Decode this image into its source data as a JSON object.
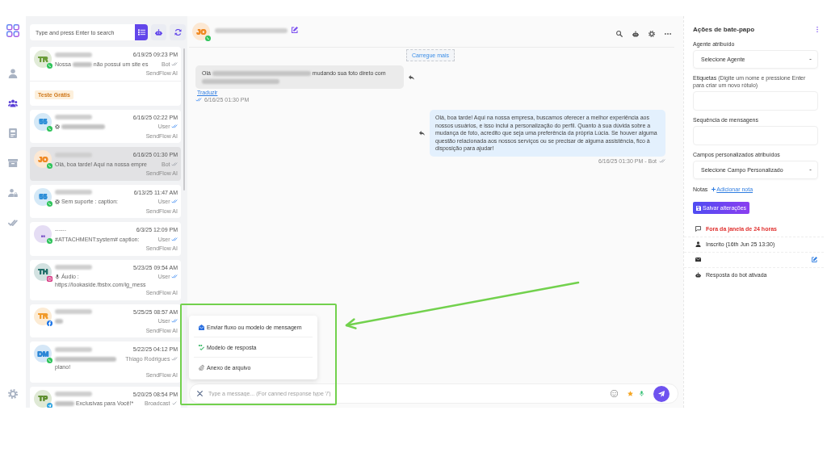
{
  "nav_rail": {
    "items": [
      {
        "kind": "contacts",
        "selected": false
      },
      {
        "kind": "team",
        "selected": true
      },
      {
        "kind": "inbox",
        "selected": false
      },
      {
        "kind": "archive",
        "selected": false
      },
      {
        "kind": "user_lock",
        "selected": false
      },
      {
        "kind": "tasks",
        "selected": false
      },
      {
        "kind": "settings",
        "selected": false
      }
    ]
  },
  "conversation_list": {
    "search": {
      "placeholder": "Type and press Enter to search"
    },
    "tools": [
      {
        "kind": "list",
        "selected": true
      },
      {
        "kind": "robot",
        "selected": false
      },
      {
        "kind": "refresh",
        "selected": false
      }
    ],
    "conversations": [
      {
        "initials": "TR",
        "color": "#6a9c38",
        "channel": {
          "kind": "whatsapp"
        },
        "name_blurred": true,
        "preview": [
          {
            "kind": "text",
            "text": "Nossa"
          },
          {
            "kind": "blurphrase"
          },
          {
            "kind": "text",
            "text": "não possui um site es"
          }
        ],
        "time": "6/19/25 09:23 PM",
        "sender": "Bot",
        "delivery": {
          "kind": "double",
          "read": false
        },
        "agent": "SendFlow AI",
        "tags": [
          "Teste Grátis"
        ],
        "selected": false
      },
      {
        "initials": "55",
        "color": "#2f8fd8",
        "channel": {
          "kind": "whatsapp"
        },
        "name_blurred": true,
        "preview": [
          {
            "kind": "gear"
          },
          {
            "kind": "blurclause"
          }
        ],
        "time": "6/16/25 02:22 PM",
        "sender": "User",
        "delivery": {
          "kind": "double",
          "read": true
        },
        "agent": "SendFlow AI",
        "selected": false
      },
      {
        "initials": "JO",
        "color": "#f08a24",
        "channel": {
          "kind": "whatsapp"
        },
        "name_blurred": true,
        "preview": [
          {
            "kind": "text",
            "text": "Olá, boa tarde! Aqui na nossa empre"
          }
        ],
        "time": "6/16/25 01:30 PM",
        "sender": "Bot",
        "delivery": {
          "kind": "double",
          "read": false
        },
        "agent": "SendFlow AI",
        "selected": true
      },
      {
        "initials": "55",
        "color": "#2f8fd8",
        "channel": {
          "kind": "whatsapp"
        },
        "name_blurred": true,
        "preview": [
          {
            "kind": "gear"
          },
          {
            "kind": "text",
            "text": "Sem suporte : caption:"
          }
        ],
        "time": "6/13/25 11:47 AM",
        "sender": "User",
        "delivery": {
          "kind": "double",
          "read": true
        },
        "agent": "SendFlow AI",
        "selected": false
      },
      {
        "initials": "..",
        "color": "#7d55c7",
        "channel": {
          "kind": "whatsapp"
        },
        "name": "------",
        "preview": [
          {
            "kind": "text",
            "text": "#ATTACHMENT:system# caption:"
          }
        ],
        "time": "6/3/25 12:09 PM",
        "sender": "User",
        "delivery": {
          "kind": "double",
          "read": true
        },
        "agent": "SendFlow AI",
        "selected": false
      },
      {
        "initials": "TH",
        "color": "#23706a",
        "channel": {
          "kind": "instagram"
        },
        "name_blurred": true,
        "preview": [
          {
            "kind": "mic"
          },
          {
            "kind": "text",
            "text": "Áudio :"
          },
          {
            "kind": "text",
            "text": "https://lookaside.fbsbx.com/ig_mess"
          }
        ],
        "time": "5/23/25 09:54 AM",
        "sender": "User",
        "delivery": {
          "kind": "double",
          "read": true
        },
        "agent": "SendFlow AI",
        "selected": false
      },
      {
        "initials": "TR",
        "color": "#f19a2a",
        "channel": {
          "kind": "facebook"
        },
        "name_blurred": true,
        "preview": [
          {
            "kind": "blurword"
          }
        ],
        "time": "5/25/25 08:57 AM",
        "sender": "User",
        "delivery": {
          "kind": "double",
          "read": true
        },
        "agent": "SendFlow AI",
        "selected": false
      },
      {
        "initials": "DM",
        "color": "#2c86d6",
        "channel": {
          "kind": "whatsapp"
        },
        "name_blurred": true,
        "preview": [
          {
            "kind": "blurline"
          },
          {
            "kind": "text",
            "text": "plano!"
          }
        ],
        "time": "5/22/25 04:12 PM",
        "sender": "Thiago Rodrigues",
        "delivery": {
          "kind": "double",
          "read": false
        },
        "agent": "SendFlow AI",
        "selected": false
      },
      {
        "initials": "TP",
        "color": "#5f8f2f",
        "channel": {
          "kind": "telegram"
        },
        "name_blurred": true,
        "preview": [
          {
            "kind": "blurphrase"
          },
          {
            "kind": "text",
            "text": "Exclusivas para Você!*"
          }
        ],
        "time": "5/20/25 08:54 PM",
        "sender": "Broadcast",
        "delivery": {
          "kind": "single",
          "read": false
        },
        "selected": false
      }
    ]
  },
  "chat": {
    "contact": {
      "initials": "JO",
      "color": "#f08a24",
      "channel": {
        "kind": "whatsapp"
      },
      "name_blurred": true
    },
    "actions": [
      {
        "kind": "search"
      },
      {
        "kind": "robot"
      },
      {
        "kind": "settings"
      },
      {
        "kind": "more"
      }
    ],
    "load_more": "Carregue mais",
    "messages": [
      {
        "kind": "incoming",
        "content": [
          {
            "kind": "text",
            "text": "Olá"
          },
          {
            "kind": "blurlong"
          },
          {
            "kind": "text",
            "text": "mudando sua foto direto com"
          },
          {
            "kind": "blursentence"
          }
        ],
        "translate": "Traduzir",
        "time": "6/16/25 01:30 PM",
        "delivery": {
          "kind": "double",
          "read": true
        }
      },
      {
        "kind": "outgoing",
        "content": [
          {
            "kind": "text",
            "text": "Olá, boa tarde! Aqui na nossa empresa, buscamos oferecer a melhor experiência aos nossos usuários, e isso inclui a personalização do perfil. Quanto à sua dúvida sobre a mudança de foto, acredito que seja uma preferência da própria Lúcia. Se houver alguma questão relacionada aos nossos serviços ou se precisar de alguma assistência, fico à disposição para ajudar!"
          }
        ],
        "time": "6/16/25 01:30 PM - Bot",
        "delivery": {
          "kind": "double",
          "read": false
        }
      }
    ],
    "attach_menu": {
      "items": [
        {
          "kind": "flow",
          "label": "Enviar fluxo ou modelo de mensagem"
        },
        {
          "kind": "template",
          "label": "Modelo de resposta"
        },
        {
          "kind": "attachment",
          "label": "Anexo de arquivo"
        }
      ]
    },
    "composer": {
      "placeholder": "Type a message... (For canned response type '/')"
    }
  },
  "chat_actions": {
    "title": "Ações de bate-papo",
    "fields": [
      {
        "kind": "select",
        "label": "Agente atribuído",
        "value": "Selecione Agente"
      },
      {
        "kind": "input",
        "label": "Etiquetas",
        "hint": "(Digite um nome e pressione Enter para criar um novo rótulo)"
      },
      {
        "kind": "input",
        "label": "Sequência de mensagens"
      },
      {
        "kind": "select",
        "label": "Campos personalizados atribuídos",
        "value": "Selecione Campo Personalizado"
      }
    ],
    "notes": {
      "label": "Notas",
      "link": "Adicionar nota"
    },
    "save_button": "Salvar alterações",
    "info": [
      {
        "kind": "window",
        "text": "Fora da janela de 24 horas",
        "alert": true,
        "editable": false
      },
      {
        "kind": "subscribed",
        "text": "Inscrito (16th Jun 25 13:30)",
        "alert": false,
        "editable": false
      },
      {
        "kind": "email",
        "editable": true
      },
      {
        "kind": "bot",
        "text": "Resposta do bot ativada",
        "alert": false,
        "editable": false
      }
    ]
  }
}
